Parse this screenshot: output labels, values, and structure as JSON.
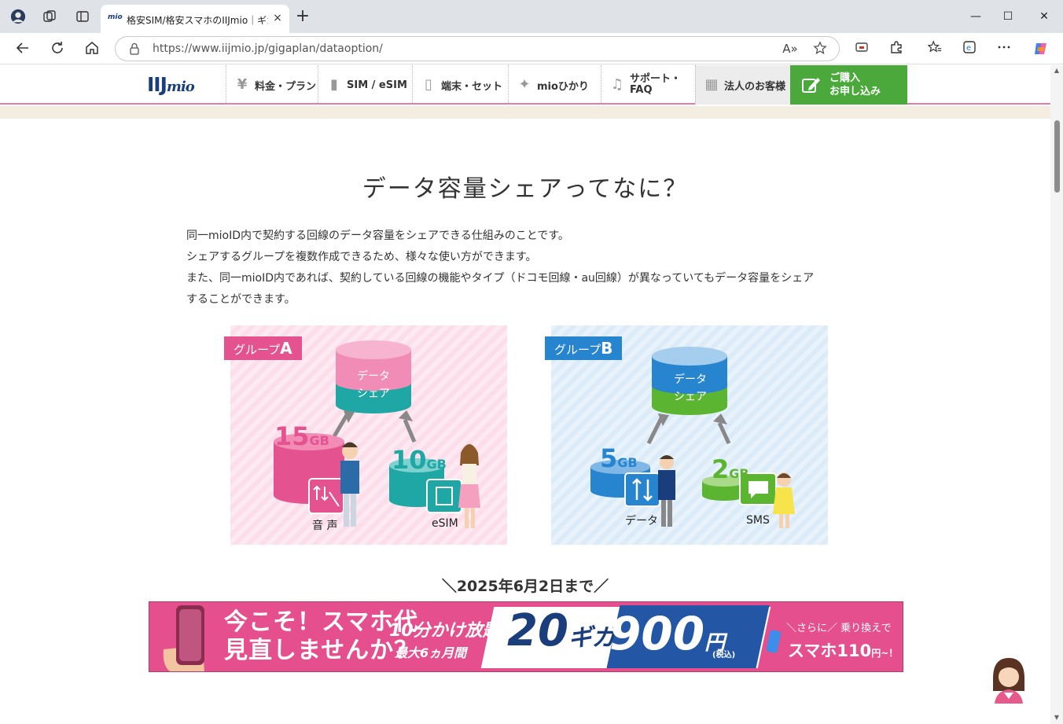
{
  "browser": {
    "tab_title": "格安SIM/格安スマホのIIJmio｜ギガプ",
    "tab_favicon_text": "mio",
    "tab_close": "×",
    "new_tab": "+",
    "url": "https://www.iijmio.jp/gigaplan/dataoption/",
    "window_controls": {
      "minimize": "—",
      "maximize": "☐",
      "close": "✕"
    },
    "read_aloud_label": "A»",
    "icons": [
      "profile-icon",
      "workspaces-icon",
      "tab-actions-icon",
      "back-icon",
      "refresh-icon",
      "home-icon",
      "lock-icon",
      "read-aloud-icon",
      "favorite-star-icon",
      "app-available-icon",
      "extensions-icon",
      "favorites-icon",
      "collections-icon",
      "more-icon",
      "copilot-icon"
    ]
  },
  "site": {
    "logo_main": "IIJ",
    "logo_sub": "mio",
    "nav": [
      {
        "label": "料金・プラン",
        "icon": "yen-icon",
        "glyph": "¥"
      },
      {
        "label": "SIM / eSIM",
        "icon": "sim-icon",
        "glyph": "▮"
      },
      {
        "label": "端末・セット",
        "icon": "device-icon",
        "glyph": "▯"
      },
      {
        "label": "mioひかり",
        "icon": "sparkle-icon",
        "glyph": "✦"
      },
      {
        "label_line1": "サポート・",
        "label_line2": "FAQ",
        "icon": "headset-icon",
        "glyph": "♫"
      },
      {
        "label": "法人のお客様",
        "icon": "building-icon",
        "glyph": "▦"
      }
    ],
    "cta_line1": "ご購入",
    "cta_line2": "お申し込み"
  },
  "content": {
    "heading": "データ容量シェアってなに？",
    "paragraph": [
      "同一mioID内で契約する回線のデータ容量をシェアできる仕組みのことです。",
      "シェアするグループを複数作成できるため、様々な使い方ができます。",
      "また、同一mioID内であれば、契約している回線の機能やタイプ（ドコモ回線・au回線）が異なっていてもデータ容量をシェア",
      "することができます。"
    ],
    "group_a": {
      "tag": "グループ",
      "tag_letter": "A",
      "share_line1": "データ",
      "share_line2": "シェア",
      "left_amount": "15",
      "left_unit": "GB",
      "left_label": "音 声",
      "right_amount": "10",
      "right_unit": "GB",
      "right_label": "eSIM",
      "colors": {
        "pink": "#e4538f",
        "pink_light": "#f7b4ce",
        "teal": "#1ea7a4"
      }
    },
    "group_b": {
      "tag": "グループ",
      "tag_letter": "B",
      "share_line1": "データ",
      "share_line2": "シェア",
      "left_amount": "5",
      "left_unit": "GB",
      "left_label": "データ",
      "right_amount": "2",
      "right_unit": "GB",
      "right_label": "SMS",
      "colors": {
        "blue": "#2784cf",
        "blue_light": "#a5cdee",
        "green": "#5cb531"
      }
    },
    "deadline": "＼2025年6月2日まで／",
    "banner": {
      "headline_line1": "今こそ！スマホ代",
      "headline_line2": "見直しませんか？",
      "sub1": "10分かけ放題",
      "sub2": "最大6ヵ月間",
      "giga_num": "20",
      "giga_unit": "ギガ",
      "price_num": "900",
      "price_unit": "円",
      "price_tax": "(税込)",
      "right_line1": "＼さらに／ 乗り換えで",
      "right_line2": "スマホ110",
      "right_line2_unit": "円~！"
    }
  }
}
